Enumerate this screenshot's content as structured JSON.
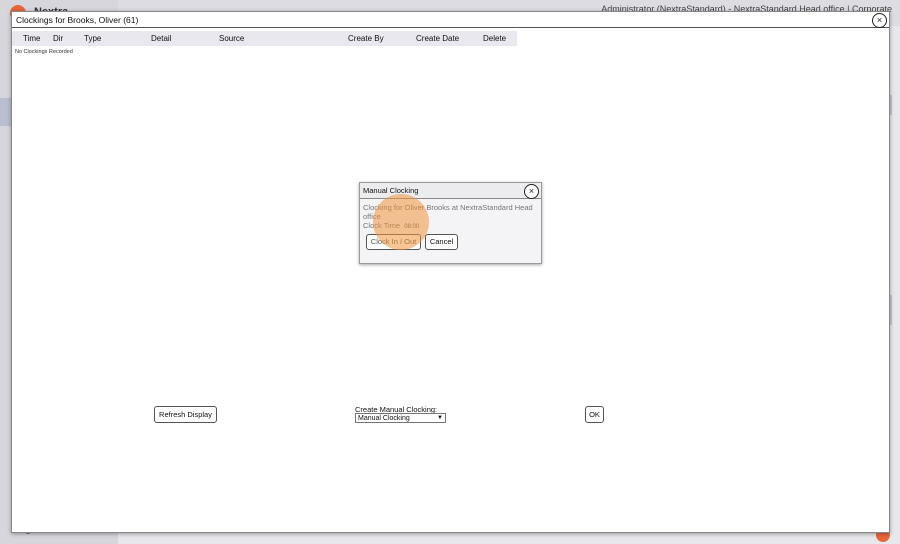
{
  "background": {
    "brand": "Nextra",
    "user_info": "Administrator (NextraStandard) - NextraStandard Head office | Corporate",
    "logout": "Logout"
  },
  "window": {
    "title": "Clockings for Brooks, Oliver (61)",
    "close_icon": "×"
  },
  "table": {
    "columns": [
      "Time",
      "Dir",
      "Type",
      "Detail",
      "Source",
      "Create By",
      "Create Date",
      "Delete"
    ],
    "empty_message": "No Clockings Recorded"
  },
  "footer": {
    "refresh_label": "Refresh Display",
    "create_label": "Create Manual Clocking:",
    "create_selected": "Manual Clocking",
    "ok_label": "OK"
  },
  "dialog": {
    "title": "Manual Clocking",
    "close_icon": "×",
    "message": "Clocking for Oliver Brooks at NextraStandard Head office",
    "clock_time_label": "Clock Time",
    "clock_time_value": "08:00",
    "clock_button": "Clock In / Out",
    "cancel_button": "Cancel"
  },
  "colors": {
    "accent": "#e8673a",
    "highlight": "#f0963c",
    "header_bg": "#e8e8ee"
  }
}
